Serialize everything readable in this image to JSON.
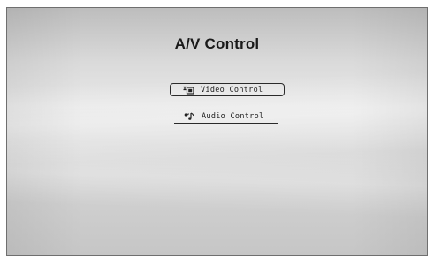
{
  "screen": {
    "title": "A/V Control"
  },
  "menu": {
    "items": [
      {
        "label": "Video Control",
        "icon": "video-icon",
        "selected": true
      },
      {
        "label": "Audio Control",
        "icon": "audio-note-icon",
        "selected": false
      }
    ]
  }
}
